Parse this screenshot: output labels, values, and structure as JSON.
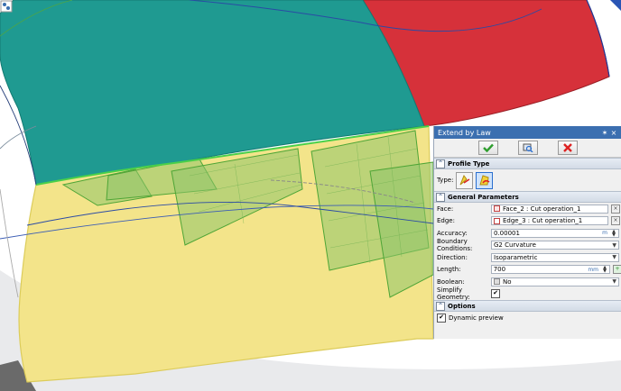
{
  "panel": {
    "title": "Extend by Law",
    "pin_glyph": "✶",
    "close_glyph": "×",
    "ok_icon": "check-icon",
    "preview_icon": "preview-icon",
    "cancel_icon": "x-icon",
    "sections": {
      "profile_type": "Profile Type",
      "general": "General Parameters",
      "options": "Options"
    },
    "type_label": "Type:",
    "face_label": "Face:",
    "face_value": "Face_2 : Cut operation_1",
    "edge_label": "Edge:",
    "edge_value": "Edge_3 : Cut operation_1",
    "accuracy_label": "Accuracy:",
    "accuracy_value": "0.00001",
    "accuracy_unit": "m",
    "boundary_label": "Boundary Conditions:",
    "boundary_value": "G2 Curvature",
    "direction_label": "Direction:",
    "direction_value": "Isoparametric",
    "length_label": "Length:",
    "length_value": "700",
    "length_unit": "mm",
    "boolean_label": "Boolean:",
    "boolean_value": "No",
    "simplify_label": "Simplify Geometry:",
    "dynamic_preview_label": "Dynamic preview",
    "check_glyph": "✔"
  },
  "colors": {
    "teal_surface": "#1f9a91",
    "red_surface": "#d6313a",
    "yellow_surface": "#f3e48a",
    "green_preview": "#8ec46a",
    "titlebar": "#3b6fb0"
  }
}
